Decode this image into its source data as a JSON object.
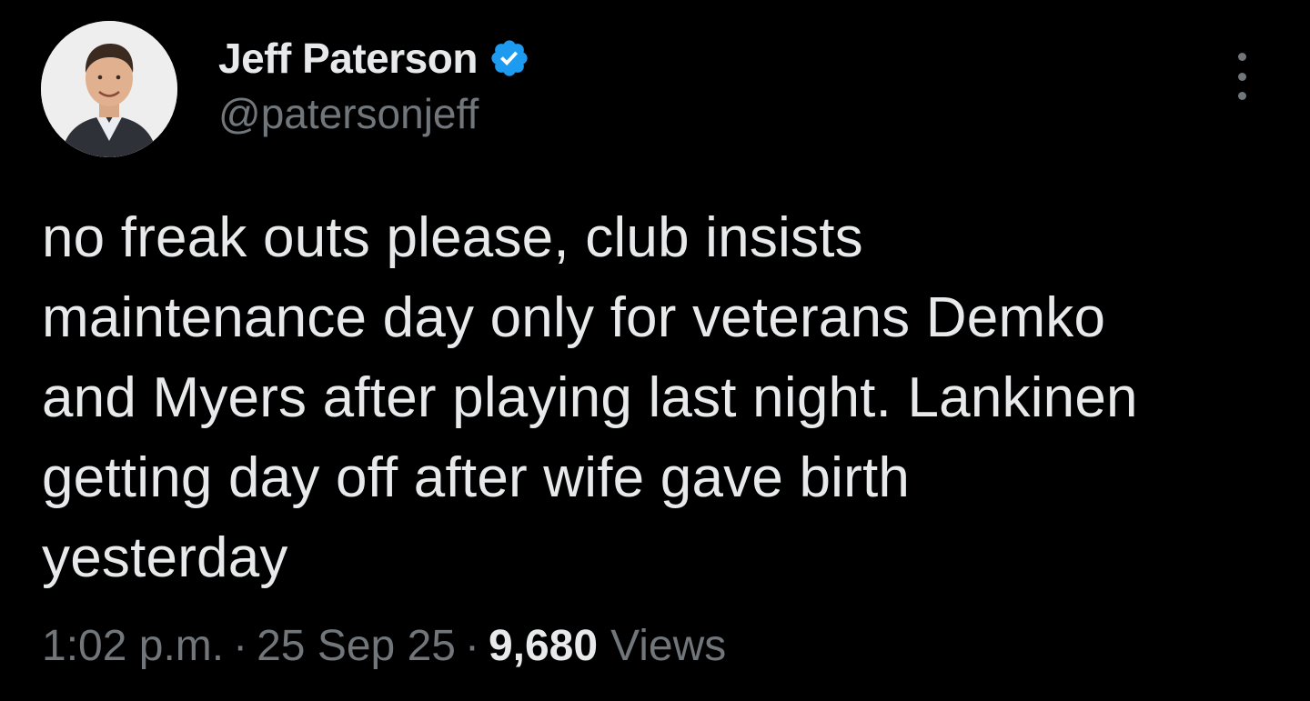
{
  "tweet": {
    "author": {
      "display_name": "Jeff Paterson",
      "handle": "@patersonjeff",
      "verified": true,
      "verified_color": "#1d9bf0"
    },
    "text": "no freak outs please, club insists\nmaintenance day only for veterans Demko\nand Myers after playing last night. Lankinen\ngetting day off after wife gave birth\nyesterday",
    "meta": {
      "time": "1:02 p.m.",
      "separator": "·",
      "date": "25 Sep 25",
      "views_count": "9,680",
      "views_label": "Views"
    }
  },
  "icons": {
    "verified": "verified-badge-icon",
    "more": "more-options-icon"
  },
  "colors": {
    "background": "#000000",
    "primary_text": "#e7e9ea",
    "secondary_text": "#71767b"
  }
}
